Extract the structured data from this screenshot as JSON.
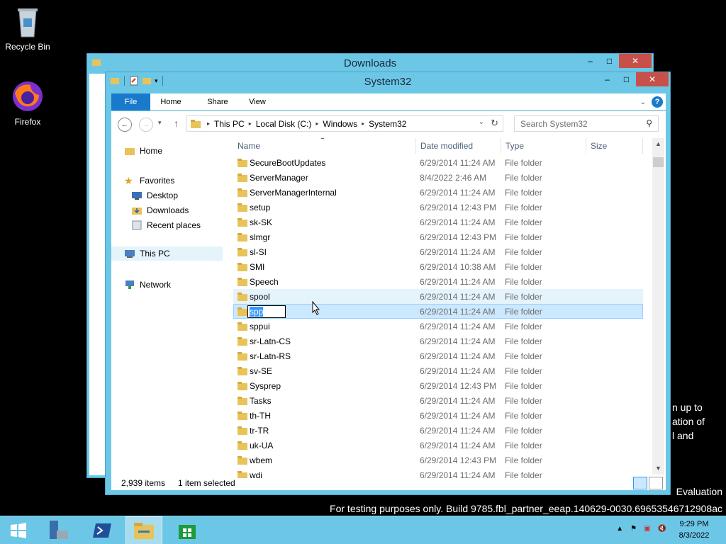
{
  "desktop": {
    "icons": [
      {
        "label": "Recycle Bin"
      },
      {
        "label": "Firefox"
      }
    ],
    "watermark_side": [
      "n up to",
      "ation of",
      "l and"
    ],
    "watermark_eval": "Evaluation",
    "watermark_build": "For testing purposes only. Build 9785.fbl_partner_eeap.140629-0030.69653546712908ac"
  },
  "back_window": {
    "title": "Downloads"
  },
  "window": {
    "title": "System32",
    "controls": {
      "minimize": "–",
      "maximize": "□",
      "close": "✕"
    },
    "ribbon_tabs": [
      "File",
      "Home",
      "Share",
      "View"
    ],
    "address": {
      "crumbs": [
        "This PC",
        "Local Disk (C:)",
        "Windows",
        "System32"
      ]
    },
    "search": {
      "placeholder": "Search System32"
    },
    "nav_pane": {
      "home": "Home",
      "favorites": "Favorites",
      "desktop": "Desktop",
      "downloads": "Downloads",
      "recent": "Recent places",
      "this_pc": "This PC",
      "network": "Network"
    },
    "columns": {
      "name": "Name",
      "date": "Date modified",
      "type": "Type",
      "size": "Size"
    },
    "files": [
      {
        "name": "SecureBootUpdates",
        "date": "6/29/2014 11:24 AM",
        "type": "File folder"
      },
      {
        "name": "ServerManager",
        "date": "8/4/2022 2:46 AM",
        "type": "File folder"
      },
      {
        "name": "ServerManagerInternal",
        "date": "6/29/2014 11:24 AM",
        "type": "File folder"
      },
      {
        "name": "setup",
        "date": "6/29/2014 12:43 PM",
        "type": "File folder"
      },
      {
        "name": "sk-SK",
        "date": "6/29/2014 11:24 AM",
        "type": "File folder"
      },
      {
        "name": "slmgr",
        "date": "6/29/2014 12:43 PM",
        "type": "File folder"
      },
      {
        "name": "sl-SI",
        "date": "6/29/2014 11:24 AM",
        "type": "File folder"
      },
      {
        "name": "SMI",
        "date": "6/29/2014 10:38 AM",
        "type": "File folder"
      },
      {
        "name": "Speech",
        "date": "6/29/2014 11:24 AM",
        "type": "File folder"
      },
      {
        "name": "spool",
        "date": "6/29/2014 11:24 AM",
        "type": "File folder"
      },
      {
        "name": "spp",
        "date": "6/29/2014 11:24 AM",
        "type": "File folder"
      },
      {
        "name": "sppui",
        "date": "6/29/2014 11:24 AM",
        "type": "File folder"
      },
      {
        "name": "sr-Latn-CS",
        "date": "6/29/2014 11:24 AM",
        "type": "File folder"
      },
      {
        "name": "sr-Latn-RS",
        "date": "6/29/2014 11:24 AM",
        "type": "File folder"
      },
      {
        "name": "sv-SE",
        "date": "6/29/2014 11:24 AM",
        "type": "File folder"
      },
      {
        "name": "Sysprep",
        "date": "6/29/2014 12:43 PM",
        "type": "File folder"
      },
      {
        "name": "Tasks",
        "date": "6/29/2014 11:24 AM",
        "type": "File folder"
      },
      {
        "name": "th-TH",
        "date": "6/29/2014 11:24 AM",
        "type": "File folder"
      },
      {
        "name": "tr-TR",
        "date": "6/29/2014 11:24 AM",
        "type": "File folder"
      },
      {
        "name": "uk-UA",
        "date": "6/29/2014 11:24 AM",
        "type": "File folder"
      },
      {
        "name": "wbem",
        "date": "6/29/2014 12:43 PM",
        "type": "File folder"
      },
      {
        "name": "wdi",
        "date": "6/29/2014 11:24 AM",
        "type": "File folder"
      }
    ],
    "hover_index": 9,
    "selected_index": 10,
    "rename_value": "spp",
    "status": {
      "count": "2,939 items",
      "selected": "1 item selected"
    }
  },
  "taskbar": {
    "clock_time": "9:29 PM",
    "clock_date": "8/3/2022"
  },
  "colors": {
    "accent": "#1979ca",
    "titlebar": "#6cc7e7",
    "folder": "#e8c35a",
    "close": "#c7504b"
  }
}
